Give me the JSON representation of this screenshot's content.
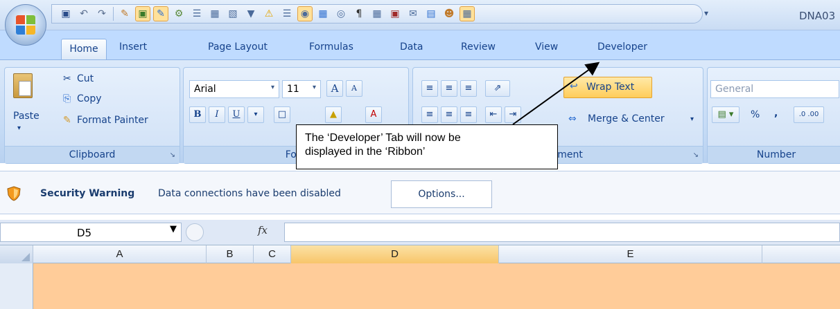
{
  "title_bar": {
    "app_title": "DNA03"
  },
  "tabs": [
    {
      "label": "Home",
      "active": true
    },
    {
      "label": "Insert"
    },
    {
      "label": "Page Layout"
    },
    {
      "label": "Formulas"
    },
    {
      "label": "Data"
    },
    {
      "label": "Review"
    },
    {
      "label": "View"
    },
    {
      "label": "Developer"
    }
  ],
  "clipboard": {
    "paste": "Paste",
    "cut": "Cut",
    "copy": "Copy",
    "format_painter": "Format Painter",
    "label": "Clipboard"
  },
  "font": {
    "name": "Arial",
    "size": "11",
    "label": "Font",
    "bold": "B",
    "italic": "I",
    "underline": "U",
    "grow": "A",
    "shrink": "A"
  },
  "alignment": {
    "wrap_text": "Wrap Text",
    "merge_center": "Merge & Center",
    "label": "Alignment"
  },
  "number": {
    "format": "General",
    "percent": "%",
    "comma": ",",
    "label": "Number"
  },
  "security_bar": {
    "title": "Security Warning",
    "message": "Data connections have been disabled",
    "options_button": "Options..."
  },
  "formula_bar": {
    "name_box": "D5",
    "fx": "fx"
  },
  "columns": [
    {
      "label": "A"
    },
    {
      "label": "B"
    },
    {
      "label": "C"
    },
    {
      "label": "D",
      "selected": true
    },
    {
      "label": "E"
    }
  ],
  "callout": {
    "text_line1": "The ‘Developer’ Tab will now be",
    "text_line2": "displayed in the ‘Ribbon’"
  },
  "colors": {
    "ribbon_bg": "#c4daf5",
    "selected_column": "#f8c56a",
    "cell_highlight": "#ffcc99",
    "accent": "#15428b"
  }
}
